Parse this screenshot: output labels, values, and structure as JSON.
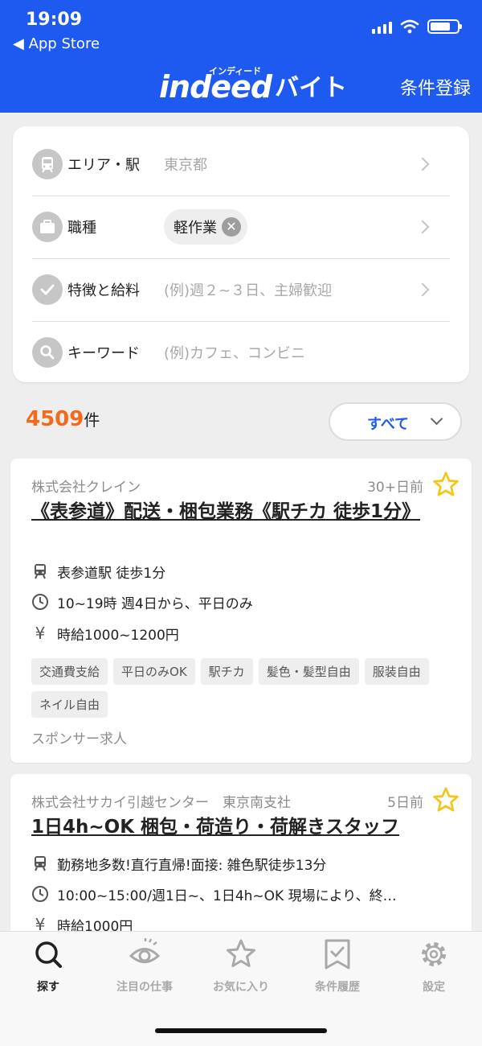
{
  "status_bar": {
    "time": "19:09",
    "back": "◀ App Store"
  },
  "header": {
    "brand_main": "indeed",
    "brand_sub": "インディード",
    "brand_baito": "バイト",
    "register": "条件登録"
  },
  "filters": {
    "area": {
      "label": "エリア・駅",
      "value": "東京都"
    },
    "job_type": {
      "label": "職種",
      "chip": "軽作業"
    },
    "features": {
      "label": "特徴と給料",
      "placeholder": "(例)週２~３日、主婦歓迎"
    },
    "keyword": {
      "label": "キーワード",
      "placeholder": "(例)カフェ、コンビニ"
    }
  },
  "results": {
    "count": "4509",
    "count_suffix": "件",
    "sort": "すべて"
  },
  "jobs": [
    {
      "company": "株式会社クレイン",
      "posted": "30+日前",
      "title": "《表参道》配送・梱包業務《駅チカ 徒歩1分》",
      "station": "表参道駅 徒歩1分",
      "hours": "10~19時 週4日から、平日のみ",
      "wage": "時給1000~1200円",
      "tags": [
        "交通費支給",
        "平日のみOK",
        "駅チカ",
        "髪色・髪型自由",
        "服装自由",
        "ネイル自由"
      ],
      "sponsor": "スポンサー求人"
    },
    {
      "company": "株式会社サカイ引越センター　東京南支社",
      "posted": "5日前",
      "title": "1日4h~OK 梱包・荷造り・荷解きスタッフ",
      "station": "勤務地多数!直行直帰!面接: 雑色駅徒歩13分",
      "hours": "10:00~15:00/週1日~、1日4h~OK 現場により、終…",
      "wage": "時給1000円"
    }
  ],
  "nav": [
    {
      "label": "探す",
      "icon": "search-icon"
    },
    {
      "label": "注目の仕事",
      "icon": "eye-icon"
    },
    {
      "label": "お気に入り",
      "icon": "star-icon"
    },
    {
      "label": "条件履歴",
      "icon": "bookmark-check-icon"
    },
    {
      "label": "設定",
      "icon": "gear-icon"
    }
  ],
  "colors": {
    "primary": "#1f5af0",
    "count": "#f26a1b",
    "star": "#f5c518"
  }
}
